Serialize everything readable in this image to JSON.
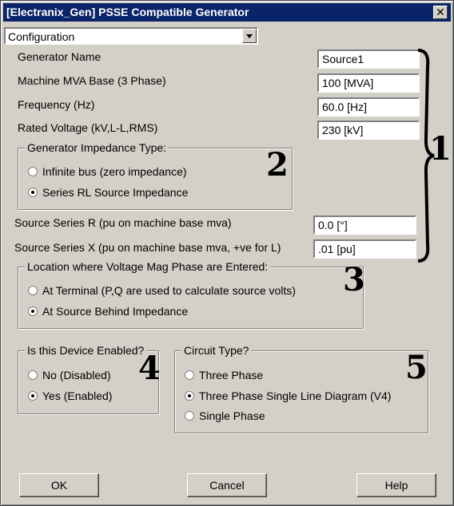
{
  "window": {
    "title": "[Electranix_Gen] PSSE Compatible Generator",
    "close_glyph": "✕"
  },
  "config_select": {
    "value": "Configuration"
  },
  "fields": [
    {
      "label": "Generator Name",
      "value": "Source1"
    },
    {
      "label": "Machine MVA Base (3 Phase)",
      "value": "100 [MVA]"
    },
    {
      "label": "Frequency (Hz)",
      "value": "60.0 [Hz]"
    },
    {
      "label": "Rated Voltage (kV,L-L,RMS)",
      "value": "230 [kV]"
    }
  ],
  "impedance_group": {
    "title": "Generator Impedance Type:",
    "options": [
      {
        "label": "Infinite bus (zero impedance)",
        "checked": false
      },
      {
        "label": "Series RL Source Impedance",
        "checked": true
      }
    ]
  },
  "series_fields": [
    {
      "label": "Source Series R (pu on machine base mva)",
      "value": "0.0 [°]"
    },
    {
      "label": "Source Series X (pu on machine base mva, +ve for L)",
      "value": ".01 [pu]"
    }
  ],
  "location_group": {
    "title": "Location where Voltage Mag  Phase are Entered:",
    "options": [
      {
        "label": "At Terminal (P,Q are used to calculate source volts)",
        "checked": false
      },
      {
        "label": "At Source Behind Impedance",
        "checked": true
      }
    ]
  },
  "enabled_group": {
    "title": "Is this Device Enabled?",
    "options": [
      {
        "label": "No (Disabled)",
        "checked": false
      },
      {
        "label": "Yes (Enabled)",
        "checked": true
      }
    ]
  },
  "circuit_group": {
    "title": "Circuit Type?",
    "options": [
      {
        "label": "Three Phase",
        "checked": false
      },
      {
        "label": "Three Phase Single Line Diagram (V4)",
        "checked": true
      },
      {
        "label": "Single Phase",
        "checked": false
      }
    ]
  },
  "annotations": [
    "1",
    "2",
    "3",
    "4",
    "5"
  ],
  "buttons": {
    "ok": "OK",
    "cancel": "Cancel",
    "help": "Help"
  }
}
